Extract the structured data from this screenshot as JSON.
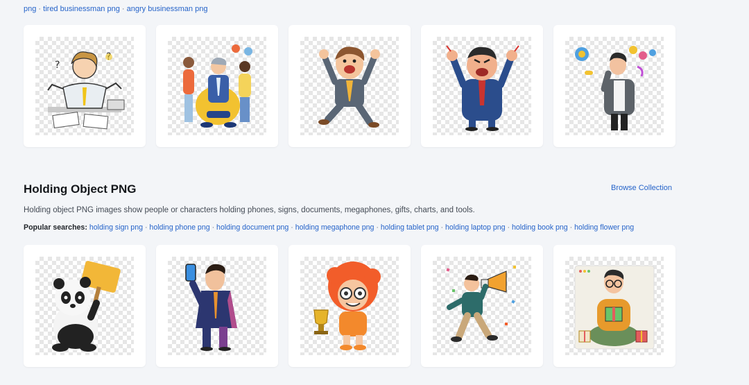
{
  "top_row": {
    "links": [
      "png",
      "tired businessman png",
      "angry businessman png"
    ]
  },
  "business_cards": [
    {
      "name": "confused-businessman-illustration"
    },
    {
      "name": "stressed-businessman-with-colleagues-illustration"
    },
    {
      "name": "happy-jumping-businessman-illustration"
    },
    {
      "name": "angry-businessman-illustration"
    },
    {
      "name": "thinking-businessman-illustration"
    }
  ],
  "holding_section": {
    "title": "Holding Object PNG",
    "browse_label": "Browse Collection",
    "description": "Holding object PNG images show people or characters holding phones, signs, documents, megaphones, gifts, charts, and tools.",
    "popular_label": "Popular searches:",
    "popular_searches": [
      "holding sign png",
      "holding phone png",
      "holding document png",
      "holding megaphone png",
      "holding tablet png",
      "holding laptop png",
      "holding book png",
      "holding flower png"
    ]
  },
  "holding_cards": [
    {
      "name": "panda-holding-sign-illustration"
    },
    {
      "name": "businessman-holding-phone-illustration"
    },
    {
      "name": "kid-holding-trophy-illustration"
    },
    {
      "name": "man-holding-megaphone-illustration"
    },
    {
      "name": "man-holding-gift-illustration"
    }
  ],
  "colors": {
    "link": "#2563c9",
    "page_bg": "#f3f5f8",
    "card_bg": "#ffffff"
  }
}
